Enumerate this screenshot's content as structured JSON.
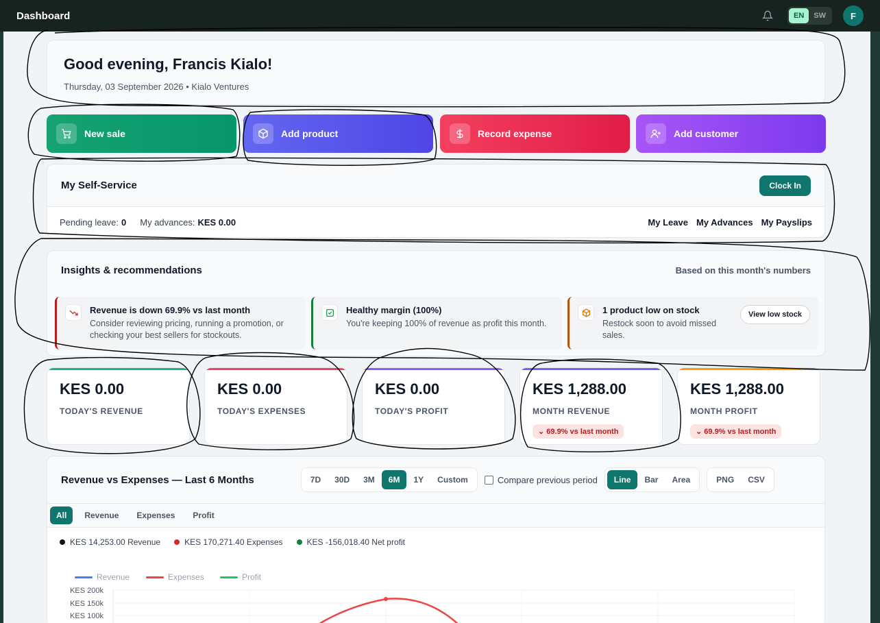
{
  "topbar": {
    "title": "Dashboard",
    "lang_en": "EN",
    "lang_sw": "SW",
    "avatar_initial": "F",
    "bell_icon": "bell-icon"
  },
  "greeting": {
    "title": "Good evening, Francis Kialo!",
    "subtitle": "Thursday, 03 September 2026 • Kialo Ventures"
  },
  "quick_actions": [
    {
      "label": "New sale",
      "icon": "cart-icon"
    },
    {
      "label": "Add product",
      "icon": "box-icon"
    },
    {
      "label": "Record expense",
      "icon": "dollar-icon"
    },
    {
      "label": "Add customer",
      "icon": "user-plus-icon"
    }
  ],
  "self_service": {
    "title": "My Self-Service",
    "clock_in": "Clock In",
    "pending_leave_label": "Pending leave:",
    "pending_leave_value": "0",
    "advances_label": "My advances:",
    "advances_value": "KES 0.00",
    "links": [
      "My Leave",
      "My Advances",
      "My Payslips"
    ]
  },
  "insights": {
    "title": "Insights & recommendations",
    "note": "Based on this month's numbers",
    "items": [
      {
        "title": "Revenue is down 69.9% vs last month",
        "body": "Consider reviewing pricing, running a promotion, or checking your best sellers for stockouts.",
        "icon": "trend-down-icon",
        "color": "#b91c1c"
      },
      {
        "title": "Healthy margin (100%)",
        "body": "You're keeping 100% of revenue as profit this month.",
        "icon": "check-square-icon",
        "color": "#15803d"
      },
      {
        "title": "1 product low on stock",
        "body": "Restock soon to avoid missed sales.",
        "icon": "package-icon",
        "color": "#b45309",
        "action": "View low stock"
      }
    ]
  },
  "kpis": [
    {
      "value": "KES 0.00",
      "label": "TODAY'S REVENUE",
      "color": "#10b981"
    },
    {
      "value": "KES 0.00",
      "label": "TODAY'S EXPENSES",
      "color": "#f43f5e"
    },
    {
      "value": "KES 0.00",
      "label": "TODAY'S PROFIT",
      "color": "#8b5cf6"
    },
    {
      "value": "KES 1,288.00",
      "label": "MONTH REVENUE",
      "color": "#6366f1",
      "change": "⌄ 69.9% vs last month"
    },
    {
      "value": "KES 1,288.00",
      "label": "MONTH PROFIT",
      "color": "#f59e0b",
      "change": "⌄ 69.9% vs last month"
    }
  ],
  "chart_panel": {
    "title": "Revenue vs Expenses — Last 6 Months",
    "ranges": [
      "7D",
      "30D",
      "3M",
      "6M",
      "1Y",
      "Custom"
    ],
    "active_range": "6M",
    "compare_label": "Compare previous period",
    "types": [
      "Line",
      "Bar",
      "Area"
    ],
    "active_type": "Line",
    "exports": [
      "PNG",
      "CSV"
    ],
    "filters": [
      "All",
      "Revenue",
      "Expenses",
      "Profit"
    ],
    "active_filter": "All",
    "summary": [
      {
        "text": "KES 14,253.00 Revenue",
        "color": "#111111"
      },
      {
        "text": "KES 170,271.40 Expenses",
        "color": "#dc2626"
      },
      {
        "text": "KES -156,018.40 Net profit",
        "color": "#15803d"
      }
    ]
  },
  "chart_data": {
    "type": "line",
    "legend": [
      "Revenue",
      "Expenses",
      "Profit"
    ],
    "legend_colors": [
      "#3b82f6",
      "#ef4444",
      "#22c55e"
    ],
    "y_ticks": [
      "KES 200k",
      "KES 150k",
      "KES 100k"
    ],
    "ylim": [
      0,
      200000
    ],
    "grid": true,
    "legend_position": "top-left",
    "series": [
      {
        "name": "Expenses",
        "color": "#ef4444",
        "values": [
          null,
          null,
          162000,
          null,
          null,
          null
        ]
      }
    ]
  }
}
